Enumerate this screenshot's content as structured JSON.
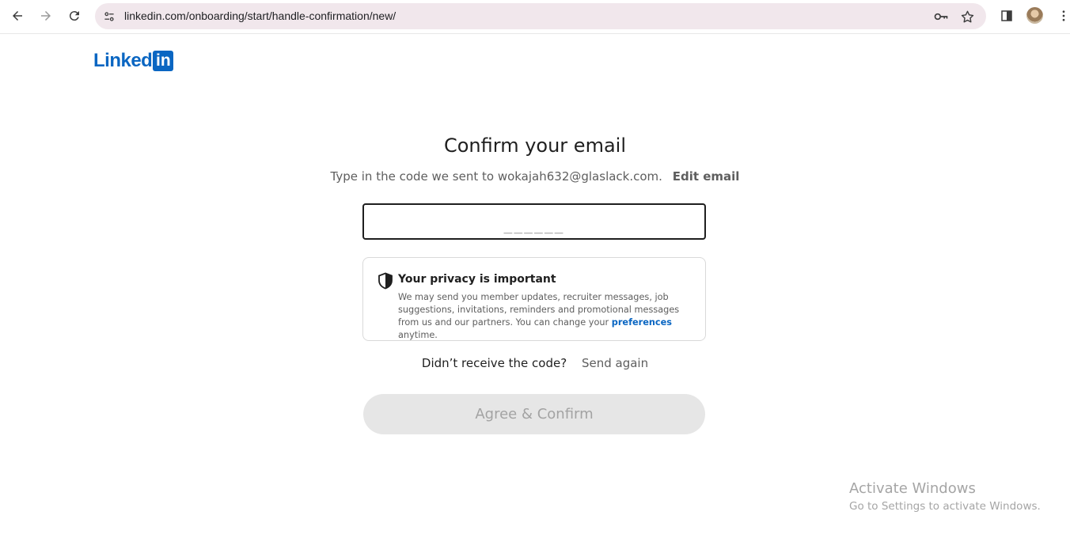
{
  "browser": {
    "url": "linkedin.com/onboarding/start/handle-confirmation/new/"
  },
  "logo": {
    "text": "Linked",
    "box_text": "in",
    "brand_color": "#0a66c2"
  },
  "main": {
    "title": "Confirm your email",
    "subtitle": "Type in the code we sent to wokajah632@glaslack.com.",
    "edit_link": "Edit email",
    "code_placeholder": "______",
    "code_value": ""
  },
  "privacy": {
    "title": "Your privacy is important",
    "body_before": "We may send you member updates, recruiter messages, job suggestions, invitations, reminders and promotional messages from us and our partners. You can change your",
    "link": "preferences",
    "body_after": "anytime."
  },
  "resend": {
    "prompt": "Didn’t receive the code?",
    "link": "Send again"
  },
  "confirm_button": "Agree & Confirm",
  "watermark": {
    "line1": "Activate Windows",
    "line2": "Go to Settings to activate Windows."
  }
}
